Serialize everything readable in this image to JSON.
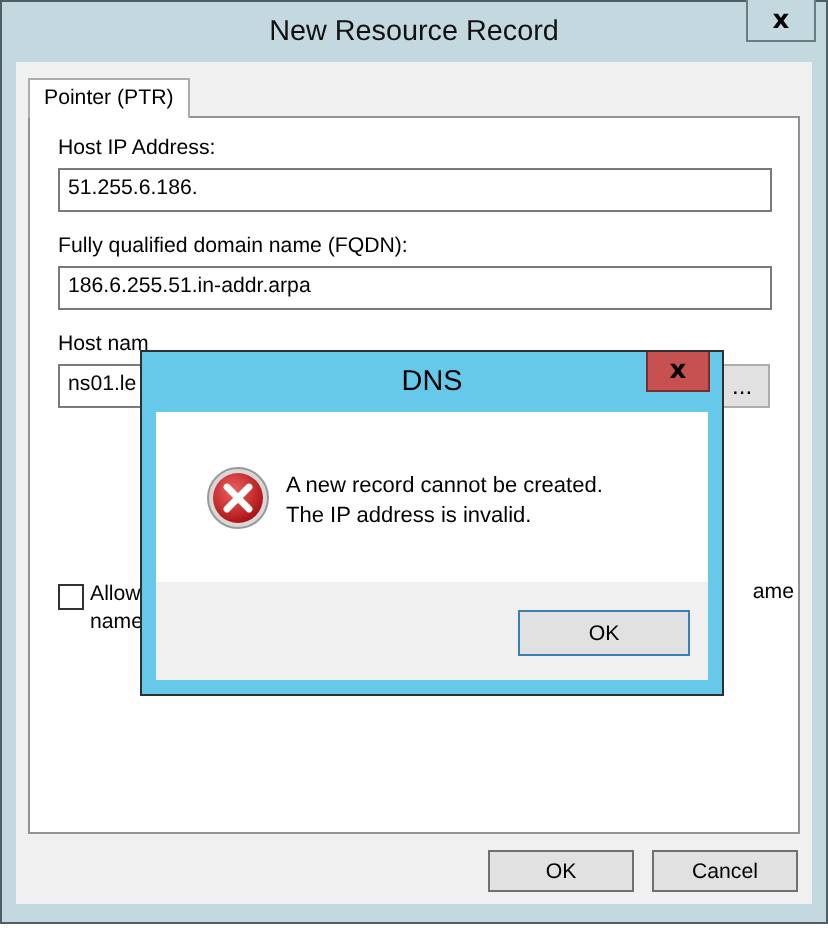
{
  "window": {
    "title": "New Resource Record",
    "close": "x"
  },
  "tabs": [
    {
      "label": "Pointer (PTR)",
      "selected": true
    }
  ],
  "fields": [
    {
      "label": "Host IP Address:",
      "value": "51.255.6.186."
    },
    {
      "label": "Fully qualified domain name (FQDN):",
      "value": "186.6.255.51.in-addr.arpa"
    }
  ],
  "host_name": {
    "label": "Host nam",
    "value": "ns01.le",
    "browse": "..."
  },
  "allow_checkbox": {
    "checked": false,
    "text_left": [
      "Allow",
      "name"
    ],
    "text_right": "ame"
  },
  "buttons": [
    "OK",
    "Cancel"
  ],
  "dialog": {
    "title": "DNS",
    "close": "x",
    "message": [
      "A new record cannot be created.",
      "The IP address is invalid."
    ],
    "button": "OK"
  }
}
